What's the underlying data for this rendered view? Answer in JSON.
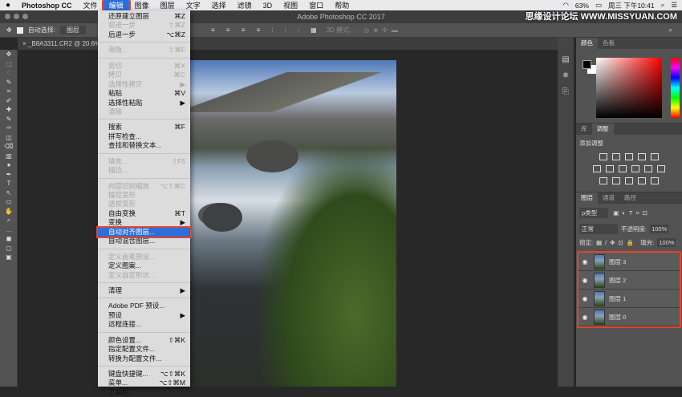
{
  "menubar": {
    "apple": "",
    "app": "Photoshop CC",
    "items": [
      "文件",
      "编辑",
      "图像",
      "图层",
      "文字",
      "选择",
      "滤镜",
      "3D",
      "视图",
      "窗口",
      "帮助"
    ],
    "active": "编辑"
  },
  "status": {
    "battery": "63%",
    "clock": "周三 下午10:41"
  },
  "watermark": "思缘设计论坛 WWW.MISSYUAN.COM",
  "window": {
    "title": "Adobe Photoshop CC 2017"
  },
  "options": {
    "auto_select_label": "自动选择:",
    "auto_select_value": "图层",
    "mode_3d": "3D 模式:"
  },
  "document_tab": "_B8A3311.CR2 @ 20.6%",
  "edit_menu": [
    {
      "label": "还原建立图层",
      "shortcut": "⌘Z"
    },
    {
      "label": "前进一步",
      "shortcut": "⇧⌘Z",
      "disabled": true
    },
    {
      "label": "后退一步",
      "shortcut": "⌥⌘Z"
    },
    {
      "sep": true
    },
    {
      "label": "渐隐...",
      "shortcut": "⇧⌘F",
      "disabled": true
    },
    {
      "sep": true
    },
    {
      "label": "剪切",
      "shortcut": "⌘X",
      "disabled": true
    },
    {
      "label": "拷贝",
      "shortcut": "⌘C",
      "disabled": true
    },
    {
      "label": "选择性拷贝",
      "shortcut": "▶",
      "disabled": true
    },
    {
      "label": "粘贴",
      "shortcut": "⌘V"
    },
    {
      "label": "选择性粘贴",
      "shortcut": "▶"
    },
    {
      "label": "清除",
      "shortcut": "",
      "disabled": true
    },
    {
      "sep": true
    },
    {
      "label": "搜索",
      "shortcut": "⌘F"
    },
    {
      "label": "拼写检查...",
      "shortcut": ""
    },
    {
      "label": "查找和替换文本...",
      "shortcut": ""
    },
    {
      "sep": true
    },
    {
      "label": "填充...",
      "shortcut": "⇧F5",
      "disabled": true
    },
    {
      "label": "描边...",
      "shortcut": "",
      "disabled": true
    },
    {
      "sep": true
    },
    {
      "label": "内容识别缩放",
      "shortcut": "⌥⇧⌘C",
      "disabled": true
    },
    {
      "label": "操控变形",
      "shortcut": "",
      "disabled": true
    },
    {
      "label": "透视变形",
      "shortcut": "",
      "disabled": true
    },
    {
      "label": "自由变换",
      "shortcut": "⌘T"
    },
    {
      "label": "变换",
      "shortcut": "▶"
    },
    {
      "label": "自动对齐图层...",
      "shortcut": "",
      "highlighted": true
    },
    {
      "label": "自动混合图层...",
      "shortcut": ""
    },
    {
      "sep": true
    },
    {
      "label": "定义画笔预设...",
      "shortcut": "",
      "disabled": true
    },
    {
      "label": "定义图案...",
      "shortcut": ""
    },
    {
      "label": "定义自定形状...",
      "shortcut": "",
      "disabled": true
    },
    {
      "sep": true
    },
    {
      "label": "清理",
      "shortcut": "▶"
    },
    {
      "sep": true
    },
    {
      "label": "Adobe PDF 预设...",
      "shortcut": ""
    },
    {
      "label": "预设",
      "shortcut": "▶"
    },
    {
      "label": "远程连接...",
      "shortcut": ""
    },
    {
      "sep": true
    },
    {
      "label": "颜色设置...",
      "shortcut": "⇧⌘K"
    },
    {
      "label": "指定配置文件...",
      "shortcut": ""
    },
    {
      "label": "转换为配置文件...",
      "shortcut": ""
    },
    {
      "sep": true
    },
    {
      "label": "键盘快捷键...",
      "shortcut": "⌥⇧⌘K"
    },
    {
      "label": "菜单...",
      "shortcut": "⌥⇧⌘M"
    },
    {
      "label": "工具栏...",
      "shortcut": ""
    }
  ],
  "color_panel": {
    "tabs": [
      "颜色",
      "色板"
    ]
  },
  "adjust_panel": {
    "tabs": [
      "库",
      "调整"
    ],
    "heading": "添加调整"
  },
  "layers_panel": {
    "tabs": [
      "图层",
      "通道",
      "路径"
    ],
    "filter": "ρ类型",
    "blend_mode": "正常",
    "opacity_label": "不透明度:",
    "opacity": "100%",
    "lock_label": "锁定:",
    "fill_label": "填充:",
    "fill": "100%",
    "layers": [
      "图层 3",
      "图层 2",
      "图层 1",
      "图层 0"
    ]
  }
}
